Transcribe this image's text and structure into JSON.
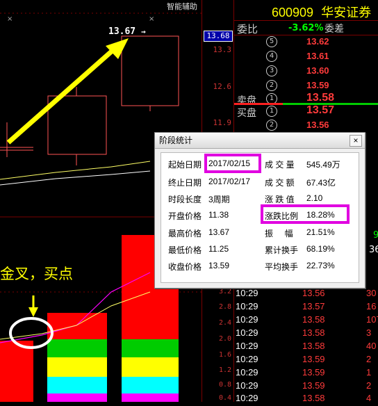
{
  "toolbar": {
    "indicator_label": "智能辅助"
  },
  "chart": {
    "price_marker": "13.67",
    "arrow_glyph": "→",
    "current_price": "13.68",
    "annotation": "金叉，买点",
    "price_axis": [
      "13.3",
      "12.6",
      "11.9"
    ],
    "volume_axis": [
      "3.2",
      "2.8",
      "2.4",
      "2.0",
      "1.6",
      "1.2",
      "0.8",
      "0.4"
    ]
  },
  "quote": {
    "code": "600909",
    "name": "华安证券",
    "weibi_label": "委比",
    "weibi_value": "-3.62%",
    "weicha_label": "委差",
    "sell_label": "卖盘",
    "buy_label": "买盘",
    "sell_levels": [
      {
        "level": "5",
        "price": "13.62"
      },
      {
        "level": "4",
        "price": "13.61"
      },
      {
        "level": "3",
        "price": "13.60"
      },
      {
        "level": "2",
        "price": "13.59"
      },
      {
        "level": "1",
        "price": "13.58"
      }
    ],
    "buy_levels": [
      {
        "level": "1",
        "price": "13.57"
      },
      {
        "level": "2",
        "price": "13.56"
      }
    ],
    "partial_values": [
      "9",
      "36"
    ],
    "trades": [
      {
        "time": "10:29",
        "price": "13.56",
        "vol": "30"
      },
      {
        "time": "10:29",
        "price": "13.57",
        "vol": "16"
      },
      {
        "time": "10:29",
        "price": "13.58",
        "vol": "107"
      },
      {
        "time": "10:29",
        "price": "13.58",
        "vol": "3"
      },
      {
        "time": "10:29",
        "price": "13.58",
        "vol": "40"
      },
      {
        "time": "10:29",
        "price": "13.59",
        "vol": "2"
      },
      {
        "time": "10:29",
        "price": "13.59",
        "vol": "1"
      },
      {
        "time": "10:29",
        "price": "13.59",
        "vol": "2"
      },
      {
        "time": "10:29",
        "price": "13.58",
        "vol": "4"
      }
    ]
  },
  "dialog": {
    "title": "阶段统计",
    "close": "×",
    "start_label": "起始日期",
    "start_value": "2017/02/15",
    "end_label": "终止日期",
    "end_value": "2017/02/17",
    "length_label": "时段长度",
    "length_value": "3周期",
    "open_label": "开盘价格",
    "open_value": "11.38",
    "high_label": "最高价格",
    "high_value": "13.67",
    "low_label": "最低价格",
    "low_value": "11.25",
    "close_label": "收盘价格",
    "close_value": "13.59",
    "vol_label": "成 交 量",
    "vol_value": "545.49万",
    "amt_label": "成 交 额",
    "amt_value": "67.43亿",
    "chg_label": "涨 跌 值",
    "chg_value": "2.10",
    "pct_label": "涨跌比例",
    "pct_value": "18.28%",
    "amp_label": "振     幅",
    "amp_value": "21.51%",
    "cum_turn_label": "累计换手",
    "cum_turn_value": "68.19%",
    "avg_turn_label": "平均换手",
    "avg_turn_value": "22.73%"
  }
}
